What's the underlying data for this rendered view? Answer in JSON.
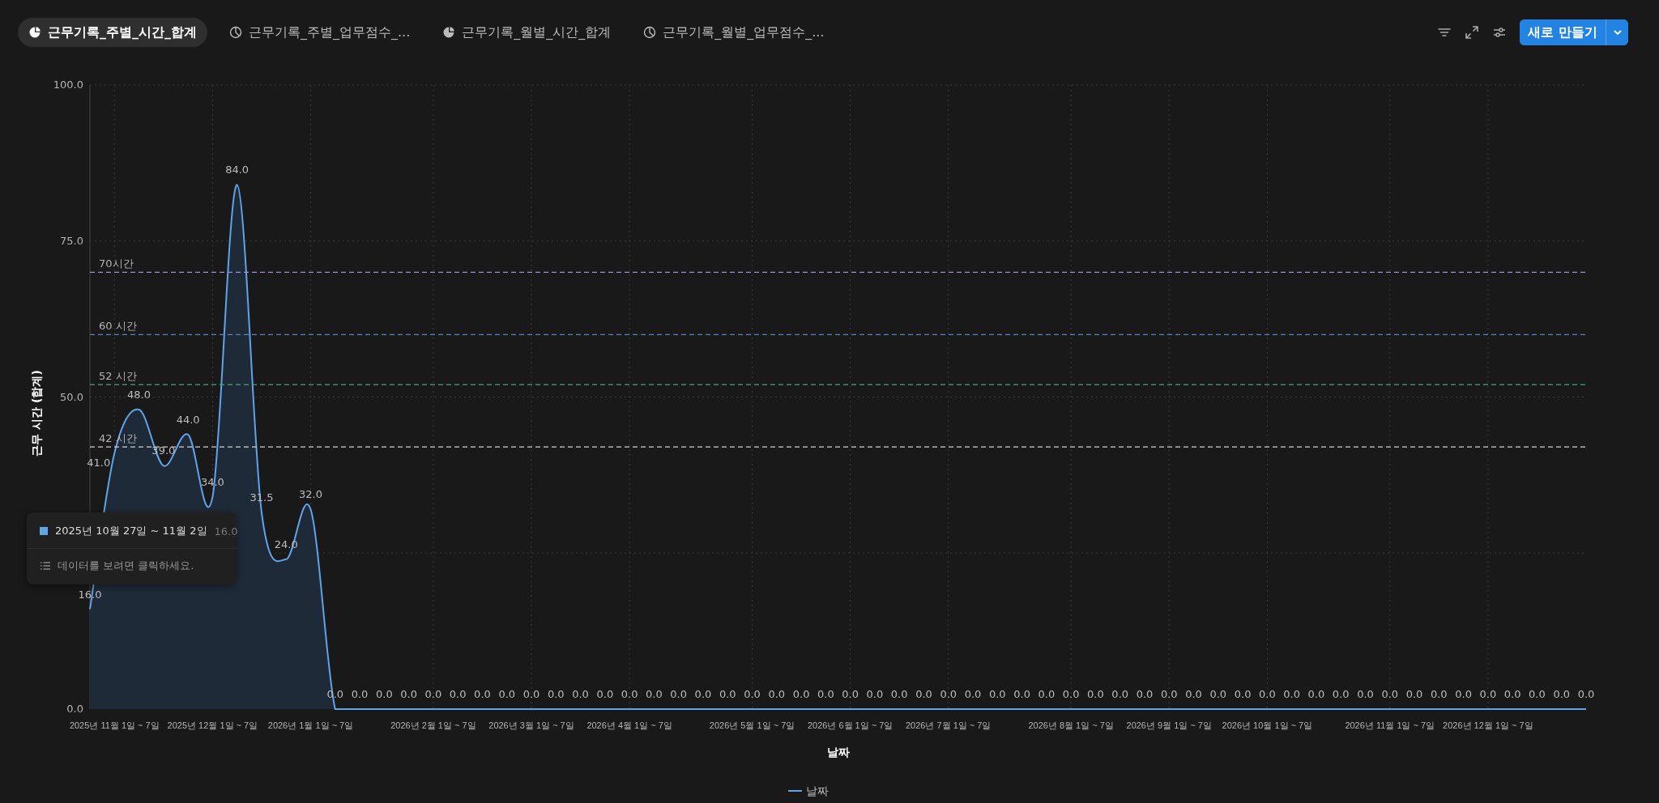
{
  "tabs": [
    {
      "label": "근무기록_주별_시간_합계",
      "selected": true,
      "kind": "filled"
    },
    {
      "label": "근무기록_주별_업무점수_...",
      "selected": false,
      "kind": "outline"
    },
    {
      "label": "근무기록_월별_시간_합계",
      "selected": false,
      "kind": "filled"
    },
    {
      "label": "근무기록_월별_업무점수_...",
      "selected": false,
      "kind": "outline"
    }
  ],
  "toolbar": {
    "new_button": "새로 만들기"
  },
  "chart": {
    "chart_data": {
      "type": "area",
      "xlabel": "날짜",
      "ylabel": "근무 시간 (합계)",
      "categories": [
        null,
        "2025년 11월 1일 ~ 7일",
        null,
        null,
        null,
        "2025년 12월 1일 ~ 7일",
        null,
        null,
        null,
        "2026년 1월 1일 ~ 7일",
        null,
        null,
        null,
        null,
        "2026년 2월 1일 ~ 7일",
        null,
        null,
        null,
        "2026년 3월 1일 ~ 7일",
        null,
        null,
        null,
        "2026년 4월 1일 ~ 7일",
        null,
        null,
        null,
        null,
        "2026년 5월 1일 ~ 7일",
        null,
        null,
        null,
        "2026년 6월 1일 ~ 7일",
        null,
        null,
        null,
        "2026년 7월 1일 ~ 7일",
        null,
        null,
        null,
        null,
        "2026년 8월 1일 ~ 7일",
        null,
        null,
        null,
        "2026년 9월 1일 ~ 7일",
        null,
        null,
        null,
        "2026년 10월 1일 ~ 7일",
        null,
        null,
        null,
        null,
        "2026년 11월 1일 ~ 7일",
        null,
        null,
        null,
        "2026년 12월 1일 ~ 7일",
        null,
        null,
        null,
        null
      ],
      "series": [
        {
          "name": "날짜",
          "color": "#5fa3e8",
          "values": [
            16,
            41,
            48,
            39,
            44,
            34,
            84,
            31.5,
            24,
            32,
            0,
            0,
            0,
            0,
            0,
            0,
            0,
            0,
            0,
            0,
            0,
            0,
            0,
            0,
            0,
            0,
            0,
            0,
            0,
            0,
            0,
            0,
            0,
            0,
            0,
            0,
            0,
            0,
            0,
            0,
            0,
            0,
            0,
            0,
            0,
            0,
            0,
            0,
            0,
            0,
            0,
            0,
            0,
            0,
            0,
            0,
            0,
            0,
            0,
            0,
            0,
            0
          ]
        }
      ],
      "value_labels": [
        "16.0",
        "41.0",
        "48.0",
        "39.0",
        "44.0",
        "34.0",
        "84.0",
        "31.5",
        "24.0",
        "32.0",
        "0.0",
        "0.0",
        "0.0",
        "0.0",
        "0.0",
        "0.0",
        "0.0",
        "0.0",
        "0.0",
        "0.0",
        "0.0",
        "0.0",
        "0.0",
        "0.0",
        "0.0",
        "0.0",
        "0.0",
        "0.0",
        "0.0",
        "0.0",
        "0.0",
        "0.0",
        "0.0",
        "0.0",
        "0.0",
        "0.0",
        "0.0",
        "0.0",
        "0.0",
        "0.0",
        "0.0",
        "0.0",
        "0.0",
        "0.0",
        "0.0",
        "0.0",
        "0.0",
        "0.0",
        "0.0",
        "0.0",
        "0.0",
        "0.0",
        "0.0",
        "0.0",
        "0.0",
        "0.0",
        "0.0",
        "0.0",
        "0.0",
        "0.0",
        "0.0",
        "0.0"
      ],
      "ylim": [
        0,
        100
      ],
      "grid": true,
      "yticks": [
        {
          "value": 0,
          "label": "0.0"
        },
        {
          "value": 50,
          "label": "50.0"
        },
        {
          "value": 75,
          "label": "75.0"
        },
        {
          "value": 100,
          "label": "100.0"
        }
      ],
      "ref_lines": [
        {
          "axis": "y",
          "value": 70,
          "label": "70시간",
          "color": "#a78bdb"
        },
        {
          "axis": "y",
          "value": 60,
          "label": "60 시간",
          "color": "#4f86c6"
        },
        {
          "axis": "y",
          "value": 52,
          "label": "52 시간",
          "color": "#4fa37a"
        },
        {
          "axis": "y",
          "value": 42,
          "label": "42 시간",
          "color": "#cfcfcf"
        }
      ]
    },
    "tooltip": {
      "title": "2025년 10월 27일 ~ 11월 2일",
      "value": "16.0",
      "hint": "데이터를 보려면 클릭하세요."
    }
  }
}
